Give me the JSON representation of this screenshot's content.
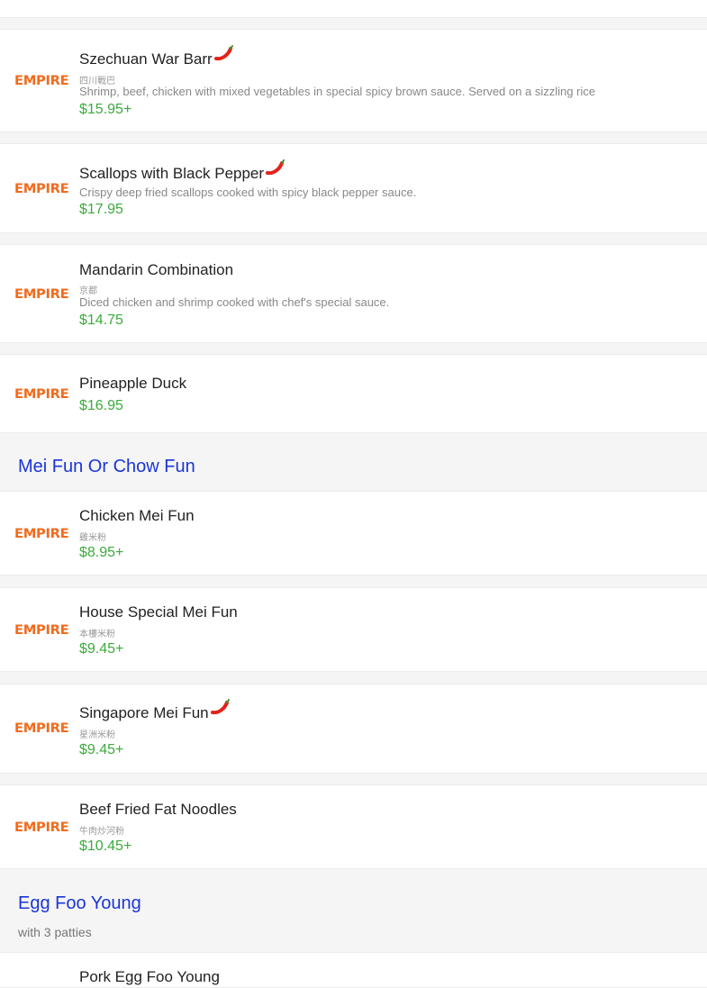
{
  "brand": {
    "logo_text": "EMPIRE",
    "accent": "#f26b1d",
    "price_color": "#3caa3c",
    "section_color": "#1a35d6"
  },
  "items": [
    {
      "name": "Szechuan War Barr",
      "cn": "四川戰巴",
      "desc": "Shrimp, beef, chicken with mixed vegetables in special spicy brown sauce. Served on a sizzling rice",
      "price": "$15.95+",
      "spicy": true
    },
    {
      "name": "Scallops with Black Pepper",
      "cn": "",
      "desc": "Crispy deep fried scallops cooked with spicy black pepper sauce.",
      "price": "$17.95",
      "spicy": true
    },
    {
      "name": "Mandarin Combination",
      "cn": "京都",
      "desc": "Diced chicken and shrimp cooked with chef's special sauce.",
      "price": "$14.75",
      "spicy": false
    },
    {
      "name": "Pineapple Duck",
      "cn": "",
      "desc": "",
      "price": "$16.95",
      "spicy": false
    }
  ],
  "sections": [
    {
      "title": "Mei Fun Or Chow Fun",
      "subtitle": ""
    },
    {
      "title": "Egg Foo Young",
      "subtitle": "with 3 patties"
    }
  ],
  "mei_fun_items": [
    {
      "name": "Chicken Mei Fun",
      "cn": "雞米粉",
      "price": "$8.95+",
      "spicy": false
    },
    {
      "name": "House Special Mei Fun",
      "cn": "本樓米粉",
      "price": "$9.45+",
      "spicy": false
    },
    {
      "name": "Singapore Mei Fun",
      "cn": "星洲米粉",
      "price": "$9.45+",
      "spicy": true
    },
    {
      "name": "Beef Fried Fat Noodles",
      "cn": "牛肉炒河粉",
      "price": "$10.45+",
      "spicy": false
    }
  ],
  "egg_items": [
    {
      "name": "Pork Egg Foo Young"
    }
  ]
}
